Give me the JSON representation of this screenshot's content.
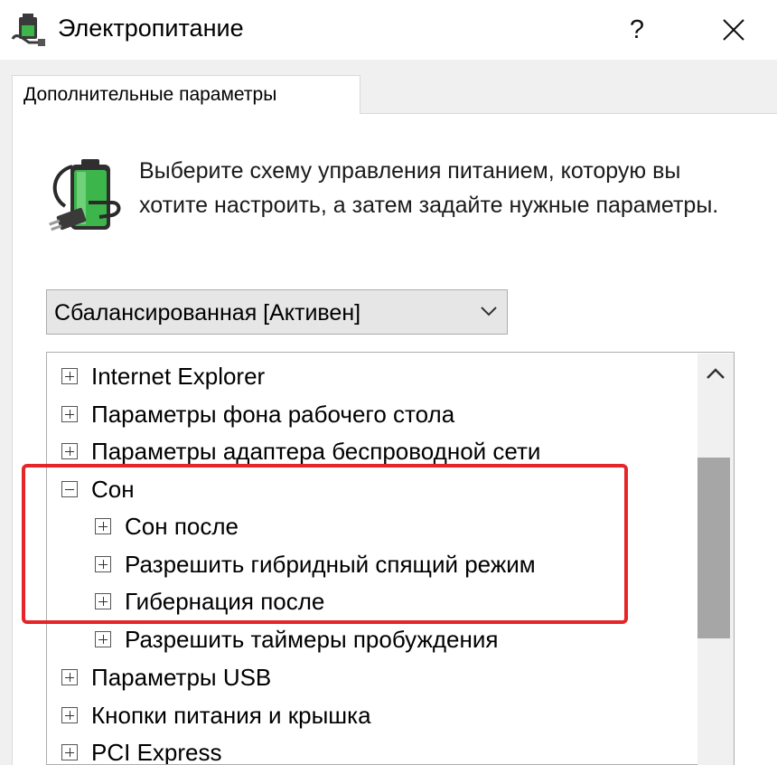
{
  "window": {
    "title": "Электропитание",
    "help_label": "?",
    "app_icon": "power-options-icon",
    "close_icon": "close-icon"
  },
  "tabs": [
    {
      "label": "Дополнительные параметры",
      "selected": true
    }
  ],
  "description": "Выберите схему управления питанием, которую вы хотите настроить, а затем задайте нужные параметры.",
  "plan_select": {
    "value": "Сбалансированная [Активен]",
    "icon": "chevron-down-icon"
  },
  "tree": {
    "items": [
      {
        "label": "Internet Explorer",
        "expander": "plus",
        "level": 0
      },
      {
        "label": "Параметры фона рабочего стола",
        "expander": "plus",
        "level": 0
      },
      {
        "label": "Параметры адаптера беспроводной сети",
        "expander": "plus",
        "level": 0
      },
      {
        "label": "Сон",
        "expander": "minus",
        "level": 0
      },
      {
        "label": "Сон после",
        "expander": "plus",
        "level": 1
      },
      {
        "label": "Разрешить гибридный спящий режим",
        "expander": "plus",
        "level": 1
      },
      {
        "label": "Гибернация после",
        "expander": "plus",
        "level": 1
      },
      {
        "label": "Разрешить таймеры пробуждения",
        "expander": "plus",
        "level": 1
      },
      {
        "label": "Параметры USB",
        "expander": "plus",
        "level": 0
      },
      {
        "label": "Кнопки питания и крышка",
        "expander": "plus",
        "level": 0
      },
      {
        "label": "PCI Express",
        "expander": "plus",
        "level": 0
      }
    ]
  },
  "scrollbar": {
    "up_icon": "chevron-up-icon"
  },
  "colors": {
    "highlight": "#e52528",
    "battery": "#3cb54a",
    "scroll_thumb": "#a6a6a6",
    "dialog_bg": "#f0f0f0"
  }
}
